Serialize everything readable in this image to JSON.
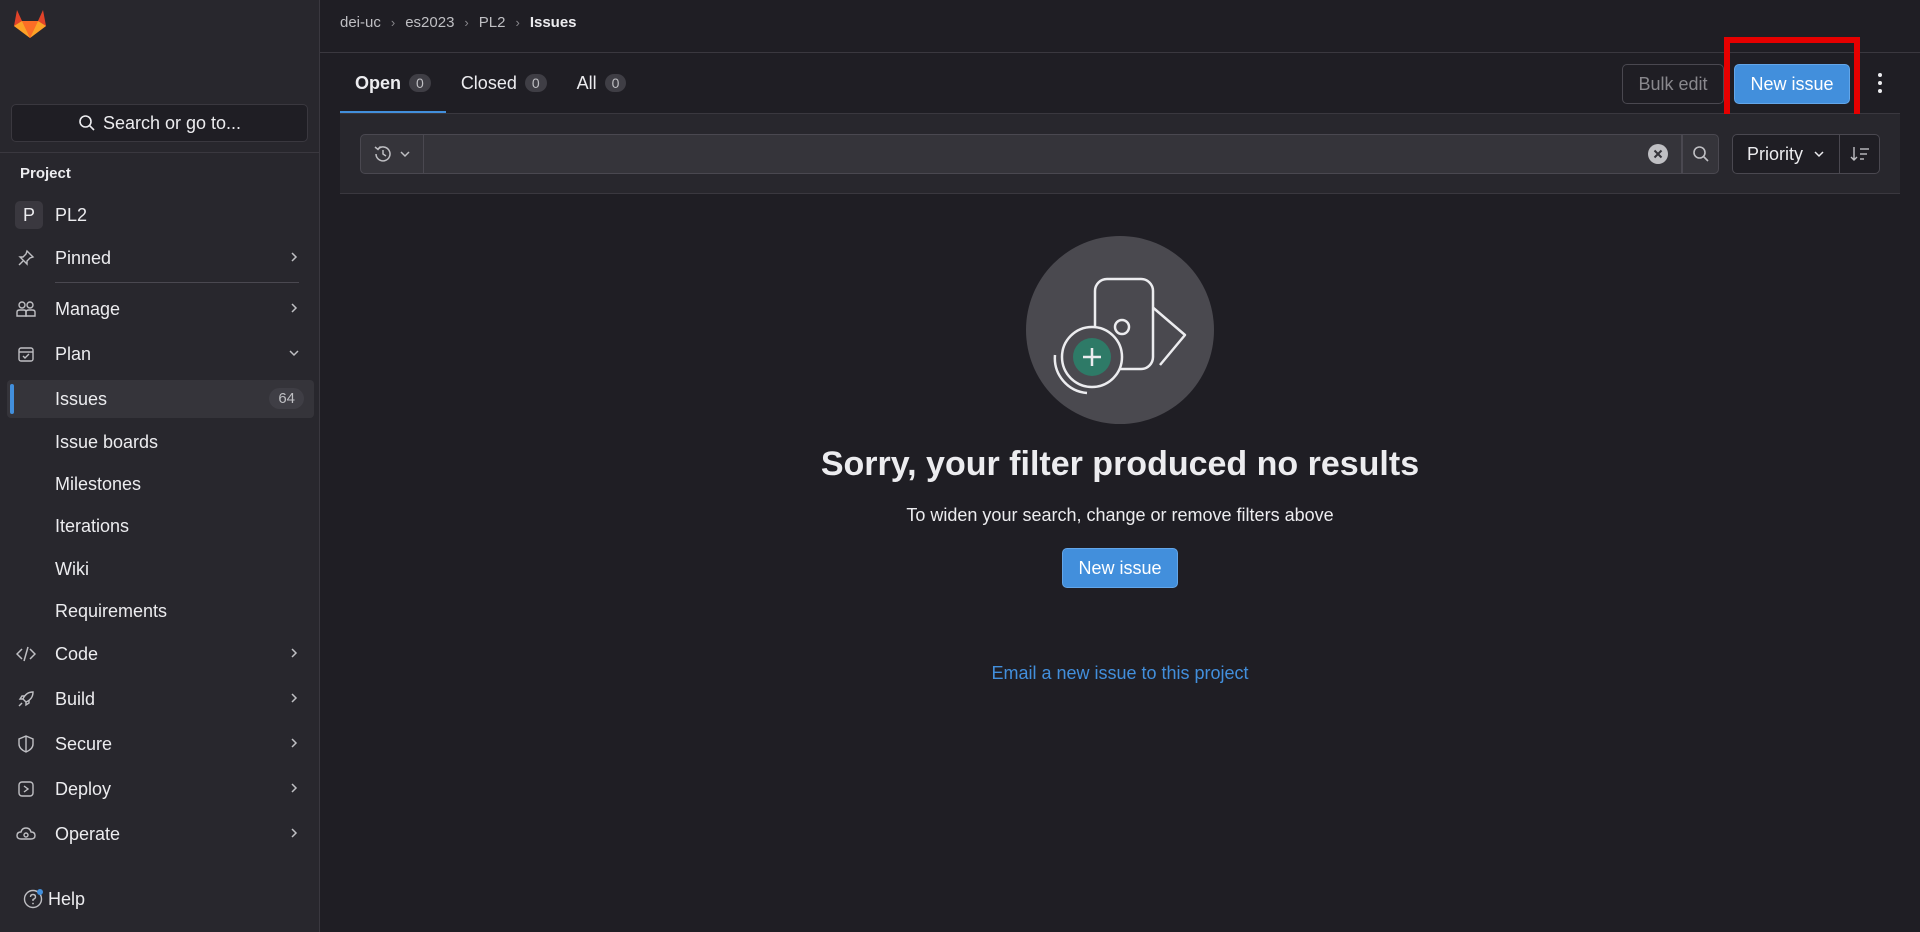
{
  "sidebar": {
    "search_label": "Search or go to...",
    "section_label": "Project",
    "project": {
      "avatar": "P",
      "name": "PL2"
    },
    "items": {
      "pinned": "Pinned",
      "manage": "Manage",
      "plan": "Plan",
      "code": "Code",
      "build": "Build",
      "secure": "Secure",
      "deploy": "Deploy",
      "operate": "Operate"
    },
    "plan_items": {
      "issues": "Issues",
      "issues_count": "64",
      "issue_boards": "Issue boards",
      "milestones": "Milestones",
      "iterations": "Iterations",
      "wiki": "Wiki",
      "requirements": "Requirements"
    },
    "help": "Help"
  },
  "breadcrumb": [
    "dei-uc",
    "es2023",
    "PL2",
    "Issues"
  ],
  "tabs": [
    {
      "label": "Open",
      "count": "0"
    },
    {
      "label": "Closed",
      "count": "0"
    },
    {
      "label": "All",
      "count": "0"
    }
  ],
  "toolbar": {
    "bulk_edit": "Bulk edit",
    "new_issue": "New issue"
  },
  "filter": {
    "value": "",
    "sort_label": "Priority"
  },
  "empty_state": {
    "title": "Sorry, your filter produced no results",
    "description": "To widen your search, change or remove filters above",
    "button": "New issue",
    "email_link": "Email a new issue to this project"
  },
  "colors": {
    "accent": "#428fdc",
    "highlight": "#e60000",
    "background": "#1f1e24",
    "sidebar": "#28272d"
  }
}
